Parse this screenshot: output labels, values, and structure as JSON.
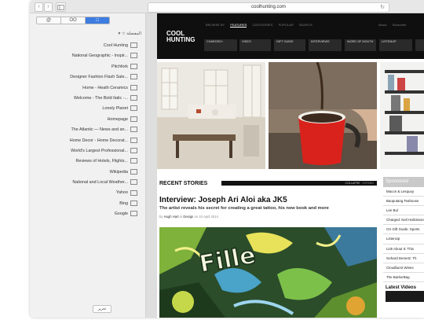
{
  "browser": {
    "url": "coolhunting.com",
    "back_icon": "chevron-left-icon",
    "forward_icon": "chevron-right-icon",
    "sidebar_toggle_icon": "sidebar-icon",
    "reload_icon": "reload-icon"
  },
  "sidebar": {
    "segments": [
      {
        "label": "@",
        "icon": "at-icon"
      },
      {
        "label": "OO",
        "icon": "reading-list-icon"
      },
      {
        "label": "□",
        "icon": "bookmarks-icon"
      }
    ],
    "header": "▾ ☆ المفضلة",
    "bookmarks": [
      "Cool Hunting",
      "National Geographic - Inspir...",
      "Pitchfork",
      "Designer Fashion Flash Sale...",
      "Home - Heath Ceramics",
      "Welcome - The Bold Italic -...",
      "Lonely Planet",
      "Homepage",
      "The Atlantic — News and an...",
      "Home Decor - Home Decorat...",
      "World's Largest Professional...",
      "Reviews of Hotels, Flights...",
      "Wikipedia",
      "National and Local Weather...",
      "Yahoo",
      "Bing",
      "Google"
    ],
    "edit_label": "تحرير"
  },
  "site": {
    "logo_line1": "COOL",
    "logo_line2": "HUNTING",
    "topnav": [
      "BROWSE BY",
      "FEATURES",
      "CATEGORIES",
      "POPULAR",
      "SEARCH"
    ],
    "topnav_right": [
      "About",
      "Subscribe"
    ],
    "subnav": [
      "CHARGED+",
      "VIDEO",
      "GIFT GUIDE",
      "INTERVIEWS",
      "WORD OF MOUTH",
      "LISTENUP"
    ],
    "recent_title": "RECENT STORIES",
    "collapse": "COLLAPSE",
    "expand": "EXPAND",
    "headline": "Interview: Joseph Ari Aloi aka JK5",
    "subhead": "The artist reveals his secret for creating a great tattoo, his new book and more",
    "byline_by": "by",
    "byline_author": "Hugh Hart",
    "byline_in": "in",
    "byline_category": "Design",
    "byline_date": "on 10 April 2014",
    "art_text": "Fille",
    "sponsored_title": "Sponsored",
    "sponsored_items": [
      "Macon & Lesquoy",
      "Baoputang Teahouse",
      "Lee Bul",
      "Charged: Neil Harbisson",
      "CH Gift Guide: Sports",
      "ListenUp",
      "Link About It: This",
      "Gehard Demetz: Th",
      "Cloudburst Wines",
      "The BarkerBag"
    ],
    "latest_title": "Latest Videos"
  }
}
